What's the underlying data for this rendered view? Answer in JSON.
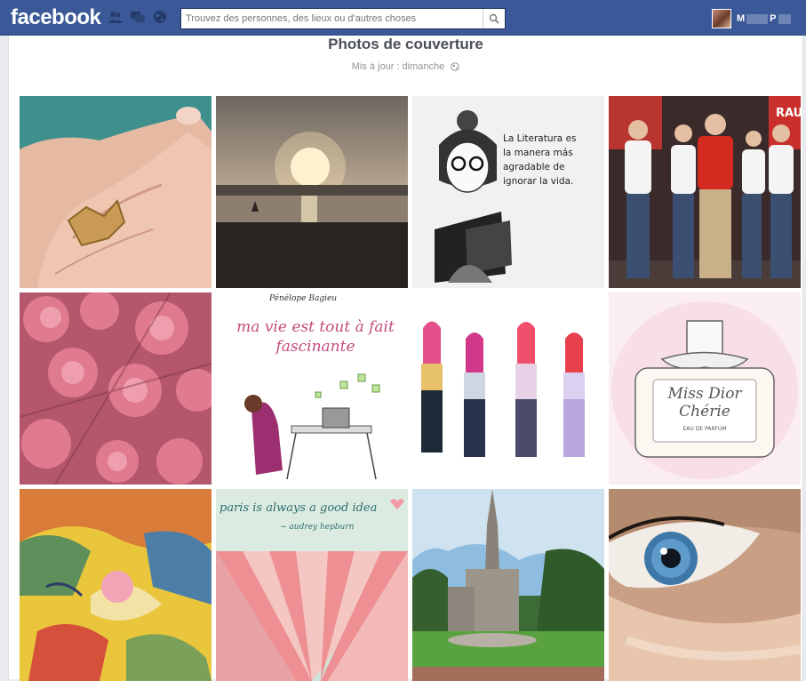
{
  "header": {
    "logo": "facebook",
    "search_placeholder": "Trouvez des personnes, des lieux ou d'autres choses",
    "user_initial": "M",
    "user_tail": "P"
  },
  "album": {
    "title": "Photos de couverture",
    "updated": "Mis à jour : dimanche"
  },
  "photos": {
    "p3_text": [
      "La Literatura es",
      "la manera más",
      "agradable de",
      "ignorar la vida."
    ],
    "p6_signature": "Pénélope Bagieu",
    "p6_text": [
      "ma vie est tout à fait",
      "fascinante"
    ],
    "p8_text": [
      "Miss Dior",
      "Chérie",
      "EAU DE PARFUM"
    ],
    "p10_text": [
      "paris is always a good idea",
      "~ audrey hepburn"
    ],
    "p4_banner": "RAU"
  },
  "colors": {
    "brand": "#3b5998",
    "page_bg": "#e9ebee"
  }
}
